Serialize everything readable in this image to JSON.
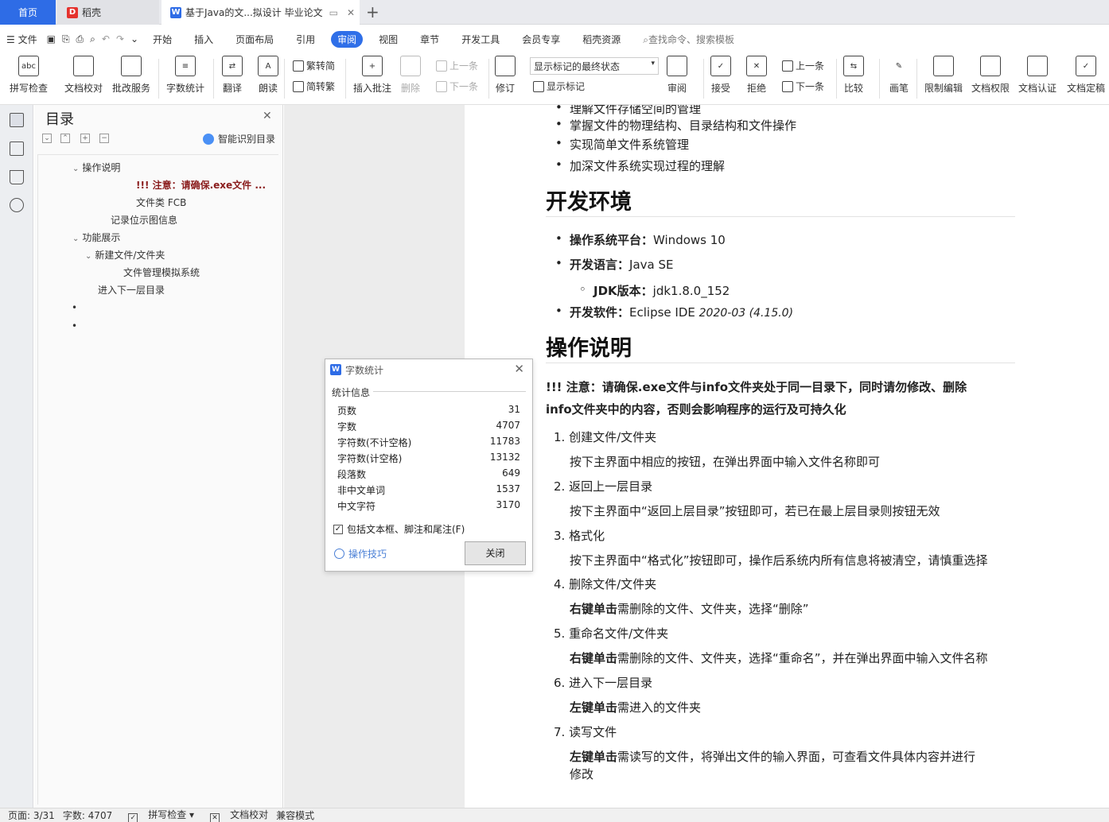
{
  "tabs": {
    "home": "首页",
    "daoke": "稻壳",
    "doc": "基于Java的文...拟设计 毕业论文",
    "new_tab": "+"
  },
  "menu": {
    "file": "文件",
    "items": [
      "开始",
      "插入",
      "页面布局",
      "引用",
      "审阅",
      "视图",
      "章节",
      "开发工具",
      "会员专享",
      "稻壳资源"
    ],
    "active": "审阅",
    "search": "查找命令、搜索模板"
  },
  "ribbon": {
    "spell": "拼写检查",
    "proofread": "文档校对",
    "correction": "批改服务",
    "wordcount": "字数统计",
    "translate": "翻译",
    "read": "朗读",
    "trad": "繁转简",
    "simp": "简转繁",
    "insert_comment": "插入批注",
    "delete": "删除",
    "prev_comment": "上一条",
    "next_comment": "下一条",
    "revise": "修订",
    "markup_mode": "显示标记的最终状态",
    "show_markup": "显示标记",
    "review": "审阅",
    "accept": "接受",
    "reject": "拒绝",
    "prev": "上一条",
    "next": "下一条",
    "compare": "比较",
    "pen": "画笔",
    "restrict": "限制编辑",
    "permission": "文档权限",
    "certify": "文档认证",
    "finalize": "文档定稿"
  },
  "toc": {
    "title": "目录",
    "smart": "智能识别目录",
    "items": [
      {
        "label": "操作说明",
        "caret": "⌄"
      },
      {
        "label": "!!! 注意：请确保.exe文件 ..."
      },
      {
        "label": "文件类 FCB"
      },
      {
        "label": "记录位示图信息"
      },
      {
        "label": "功能展示",
        "caret": "⌄"
      },
      {
        "label": "新建文件/文件夹",
        "caret": "⌄"
      },
      {
        "label": "文件管理模拟系统"
      },
      {
        "label": "进入下一层目录"
      },
      {
        "label": "•"
      },
      {
        "label": "•"
      }
    ]
  },
  "doc": {
    "top_bullets": [
      "理解文件存储空间的管理",
      "掌握文件的物理结构、目录结构和文件操作",
      "实现简单文件系统管理",
      "加深文件系统实现过程的理解"
    ],
    "h_env": "开发环境",
    "env": {
      "os_label": "操作系统平台：",
      "os_value": "Windows 10",
      "lang_label": "开发语言：",
      "lang_value": "Java SE",
      "jdk_label": "JDK版本：",
      "jdk_value": "jdk1.8.0_152",
      "ide_label": "开发软件：",
      "ide_value": "Eclipse IDE ",
      "ide_version": "2020-03 (4.15.0)"
    },
    "h_ops": "操作说明",
    "warn_line1": "!!! 注意：请确保.exe文件与info文件夹处于同一目录下，同时请勿修改、删除",
    "warn_line2": "info文件夹中的内容，否则会影响程序的运行及可持久化",
    "steps": [
      {
        "num": "1.",
        "title": "创建文件/文件夹",
        "bold": "",
        "desc": "按下主界面中相应的按钮，在弹出界面中输入文件名称即可"
      },
      {
        "num": "2.",
        "title": "返回上一层目录",
        "bold": "",
        "desc": "按下主界面中“返回上层目录”按钮即可，若已在最上层目录则按钮无效"
      },
      {
        "num": "3.",
        "title": "格式化",
        "bold": "",
        "desc": "按下主界面中“格式化”按钮即可，操作后系统内所有信息将被清空，请慎重选择"
      },
      {
        "num": "4.",
        "title": "删除文件/文件夹",
        "bold": "右键单击",
        "desc": "需删除的文件、文件夹，选择“删除”"
      },
      {
        "num": "5.",
        "title": "重命名文件/文件夹",
        "bold": "右键单击",
        "desc": "需删除的文件、文件夹，选择“重命名”，并在弹出界面中输入文件名称"
      },
      {
        "num": "6.",
        "title": "进入下一层目录",
        "bold": "左键单击",
        "desc": "需进入的文件夹"
      },
      {
        "num": "7.",
        "title": "读写文件",
        "bold": "左键单击",
        "desc": "需读写的文件，将弹出文件的输入界面，可查看文件具体内容并进行"
      }
    ],
    "step7_cont": "修改"
  },
  "dialog": {
    "title": "字数统计",
    "section": "统计信息",
    "rows": [
      {
        "label": "页数",
        "value": "31"
      },
      {
        "label": "字数",
        "value": "4707"
      },
      {
        "label": "字符数(不计空格)",
        "value": "11783"
      },
      {
        "label": "字符数(计空格)",
        "value": "13132"
      },
      {
        "label": "段落数",
        "value": "649"
      },
      {
        "label": "非中文单词",
        "value": "1537"
      },
      {
        "label": "中文字符",
        "value": "3170"
      }
    ],
    "checkbox": "包括文本框、脚注和尾注(F)",
    "tips": "操作技巧",
    "close": "关闭"
  },
  "status": {
    "page": "页面: 3/31",
    "words": "字数: 4707",
    "spell": "拼写检查",
    "proof": "文档校对",
    "compat": "兼容模式"
  },
  "colors": {
    "accent": "#2e6ce6",
    "daoke": "#e5322d"
  }
}
